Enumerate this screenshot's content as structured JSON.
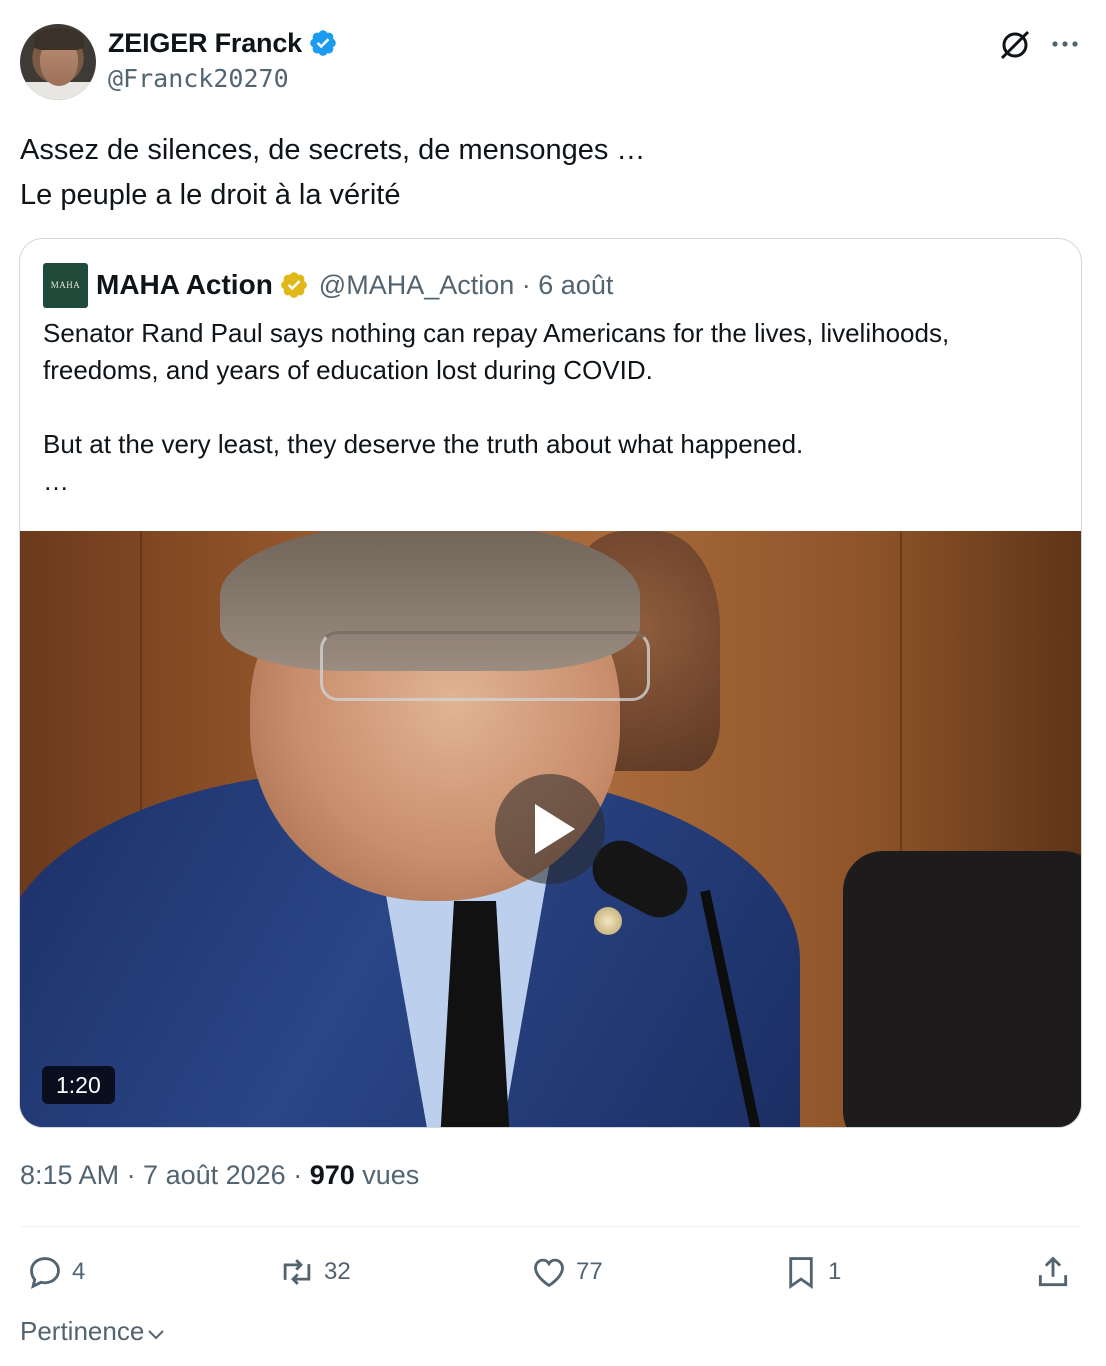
{
  "author": {
    "name": "ZEIGER Franck",
    "handle": "@Franck20270",
    "verified_color": "#1d9bf0"
  },
  "post": {
    "lines": [
      "Assez de silences, de secrets, de mensonges …",
      "Le peuple a le droit à la vérité"
    ]
  },
  "quoted": {
    "avatar_text": "MAHA",
    "name": "MAHA Action",
    "meta": "@MAHA_Action · 6 août",
    "badge_color": "#e2b719",
    "paragraph1": "Senator Rand Paul says nothing can repay Americans for the lives, livelihoods, freedoms, and years of education lost during COVID.",
    "paragraph2": "But at the very least, they deserve the truth about what happened.",
    "ellipsis": "…",
    "video_duration": "1:20"
  },
  "meta": {
    "time_date": "8:15 AM · 7 août 2026 · ",
    "views_count": "970",
    "views_label": " vues"
  },
  "actions": {
    "replies": "4",
    "reposts": "32",
    "likes": "77",
    "bookmarks": "1"
  },
  "sort_label": "Pertinence",
  "icons": [
    "grok-icon",
    "more-icon",
    "verified-badge-icon",
    "gold-badge-icon",
    "play-icon",
    "reply-icon",
    "repost-icon",
    "like-icon",
    "bookmark-icon",
    "share-icon",
    "chevron-down-icon"
  ]
}
